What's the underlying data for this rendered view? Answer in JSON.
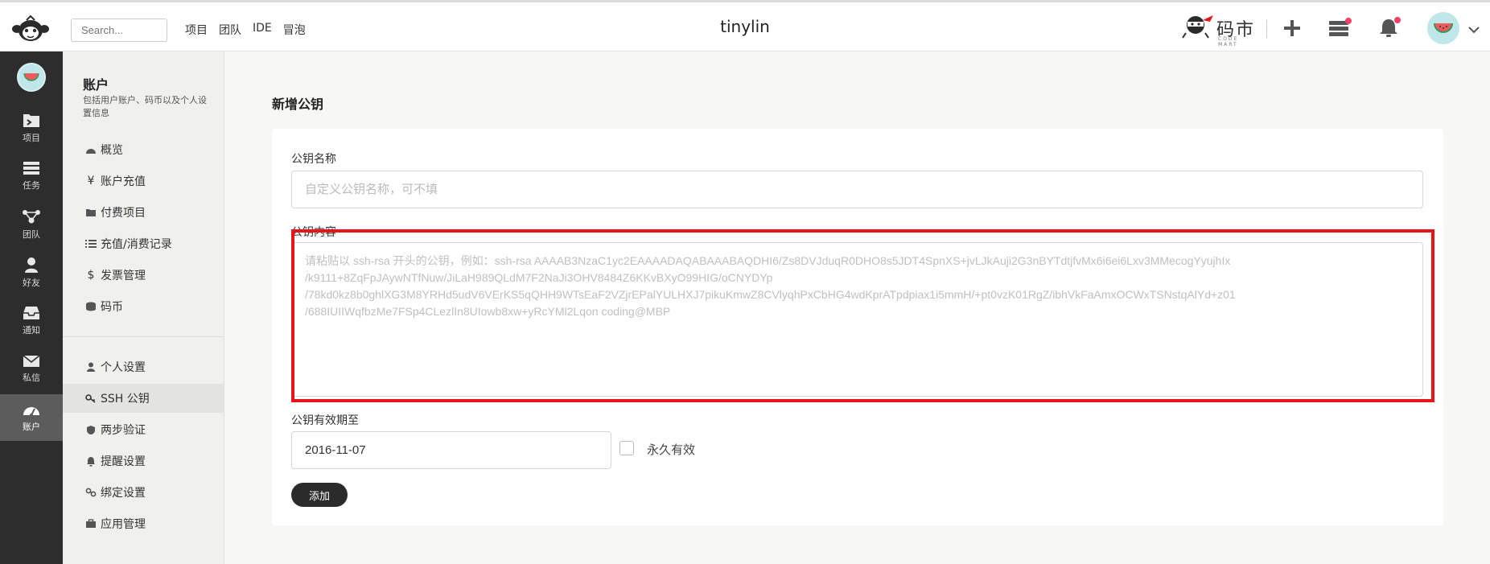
{
  "header": {
    "search_placeholder": "Search...",
    "nav": [
      "项目",
      "团队",
      "IDE",
      "冒泡"
    ],
    "title": "tinylin",
    "brand_text": "码市",
    "brand_sub": "CODE MART",
    "icons": [
      "plus-icon",
      "server-icon",
      "bell-icon"
    ]
  },
  "leftbar": {
    "items": [
      {
        "label": "项目",
        "icon": "project-icon"
      },
      {
        "label": "任务",
        "icon": "task-icon"
      },
      {
        "label": "团队",
        "icon": "team-icon"
      },
      {
        "label": "好友",
        "icon": "friend-icon"
      },
      {
        "label": "通知",
        "icon": "inbox-icon"
      },
      {
        "label": "私信",
        "icon": "mail-icon"
      },
      {
        "label": "账户",
        "icon": "dashboard-icon",
        "active": true
      }
    ]
  },
  "subbar": {
    "title": "账户",
    "description": "包括用户账户、码币以及个人设置信息",
    "group1": [
      {
        "label": "概览",
        "icon": "dashboard-icon"
      },
      {
        "label": "账户充值",
        "icon": "yen-icon"
      },
      {
        "label": "付费项目",
        "icon": "folder-icon"
      },
      {
        "label": "充值/消费记录",
        "icon": "list-icon"
      },
      {
        "label": "发票管理",
        "icon": "dollar-icon"
      },
      {
        "label": "码币",
        "icon": "coins-icon"
      }
    ],
    "group2": [
      {
        "label": "个人设置",
        "icon": "user-icon"
      },
      {
        "label": "SSH 公钥",
        "icon": "key-icon",
        "active": true
      },
      {
        "label": "两步验证",
        "icon": "shield-icon"
      },
      {
        "label": "提醒设置",
        "icon": "bell-icon"
      },
      {
        "label": "绑定设置",
        "icon": "link-icon"
      },
      {
        "label": "应用管理",
        "icon": "briefcase-icon"
      }
    ]
  },
  "main": {
    "title": "新增公钥",
    "name_label": "公钥名称",
    "name_placeholder": "自定义公钥名称，可不填",
    "content_label": "公钥内容",
    "content_placeholder": "请粘贴以 ssh-rsa 开头的公钥，例如：ssh-rsa AAAAB3NzaC1yc2EAAAADAQABAAABAQDHI6/Zs8DVJduqR0DHO8s5JDT4SpnXS+jvLJkAuji2G3nBYTdtjfvMx6i6ei6Lxv3MMecogYyujhIx\n/k9111+8ZqFpJAywNTfNuw/JiLaH989QLdM7F2NaJi3OHV8484Z6KKvBXyO99HIG/oCNYDYp\n/78kd0kz8b0ghlXG3M8YRHd5udV6VErKS5qQHH9WTsEaF2VZjrEPalYULHXJ7pikuKmwZ8CVlyqhPxCbHG4wdKprATpdpiax1i5mmH/+pt0vzK01RgZ/ibhVkFaAmxOCWxTSNstqAlYd+z01\n/688IUIIWqfbzMe7FSp4CLezlIn8UIowb8xw+yRcYMl2Lqon coding@MBP",
    "expiry_label": "公钥有效期至",
    "expiry_value": "2016-11-07",
    "permanent_label": "永久有效",
    "permanent_checked": false,
    "add_button": "添加"
  },
  "colors": {
    "sidebar_dark": "#2d2d2d",
    "highlight_red": "#e8141a",
    "button_dark": "#2b2b2b"
  }
}
